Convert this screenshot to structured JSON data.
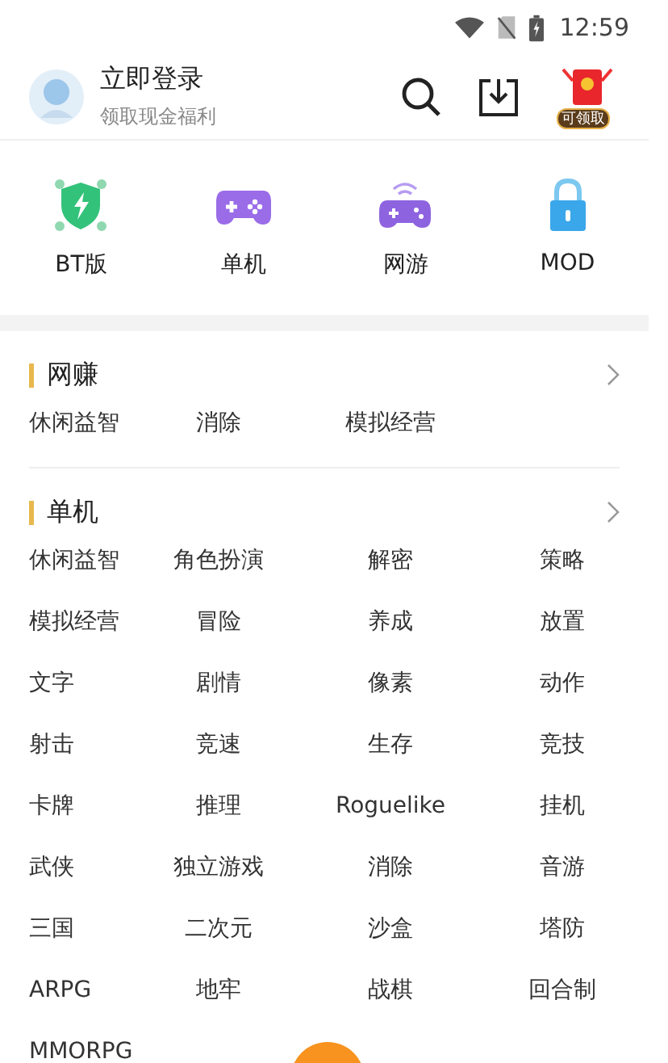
{
  "status_bar": {
    "time": "12:59"
  },
  "header": {
    "title": "立即登录",
    "subtitle": "领取现金福利",
    "reward_badge": "可领取"
  },
  "categories": [
    {
      "label": "BT版",
      "kind": "bt"
    },
    {
      "label": "单机",
      "kind": "single"
    },
    {
      "label": "网游",
      "kind": "online"
    },
    {
      "label": "MOD",
      "kind": "mod"
    }
  ],
  "sections": [
    {
      "title": "网赚",
      "tags": [
        "休闲益智",
        "消除",
        "模拟经营"
      ]
    },
    {
      "title": "单机",
      "tags": [
        "休闲益智",
        "角色扮演",
        "解密",
        "策略",
        "模拟经营",
        "冒险",
        "养成",
        "放置",
        "文字",
        "剧情",
        "像素",
        "动作",
        "射击",
        "竞速",
        "生存",
        "竞技",
        "卡牌",
        "推理",
        "Roguelike",
        "挂机",
        "武侠",
        "独立游戏",
        "消除",
        "音游",
        "三国",
        "二次元",
        "沙盒",
        "塔防",
        "ARPG",
        "地牢",
        "战棋",
        "回合制",
        "MMORPG"
      ]
    }
  ]
}
